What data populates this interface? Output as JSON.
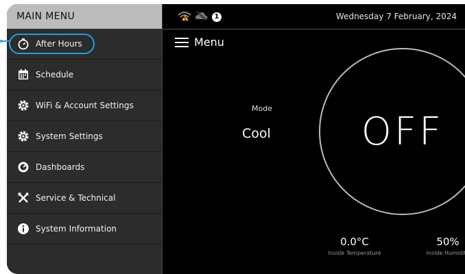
{
  "sidebar": {
    "title": "MAIN MENU",
    "items": [
      {
        "label": "After Hours",
        "icon": "stopwatch-icon"
      },
      {
        "label": "Schedule",
        "icon": "calendar-icon"
      },
      {
        "label": "WiFi & Account Settings",
        "icon": "gear-icon"
      },
      {
        "label": "System Settings",
        "icon": "gear-icon"
      },
      {
        "label": "Dashboards",
        "icon": "gauge-icon"
      },
      {
        "label": "Service & Technical",
        "icon": "tools-icon"
      },
      {
        "label": "System Information",
        "icon": "info-icon"
      }
    ]
  },
  "status": {
    "icons": [
      "wifi-warning-icon",
      "cloud-off-icon",
      "alert-icon"
    ],
    "alert_count": "1",
    "date": "Wednesday 7 February, 2024"
  },
  "main": {
    "menu_label": "Menu",
    "mode_label": "Mode",
    "mode_value": "Cool",
    "power_state": "OFF",
    "temperature_value": "0.0°C",
    "temperature_caption": "Inside Temperature",
    "humidity_value": "50%",
    "humidity_caption": "Inside Humidity"
  },
  "colors": {
    "highlight": "#1aa3e6",
    "sidebar_header": "#bcbcbc",
    "sidebar_bg": "#2c2c2c",
    "warning": "#f5a623"
  }
}
